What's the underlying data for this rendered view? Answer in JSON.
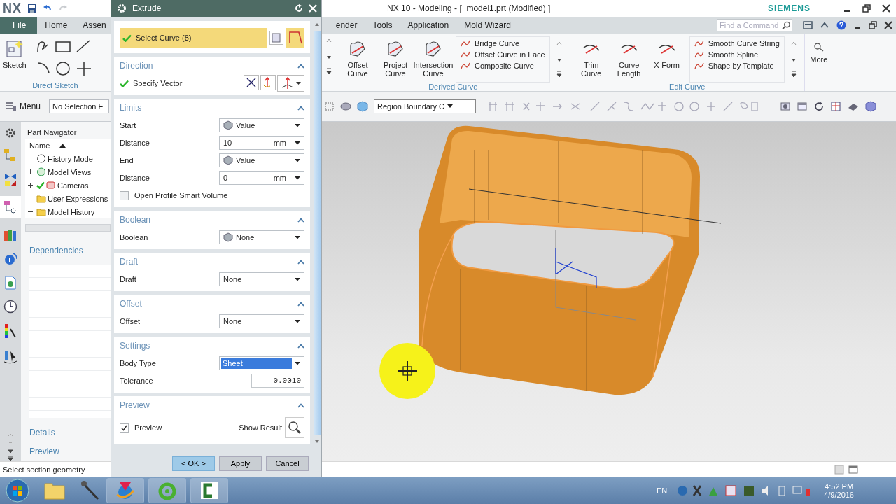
{
  "window": {
    "logo": "NX",
    "title": "NX 10 - Modeling - [_model1.prt (Modified) ]",
    "brand": "SIEMENS"
  },
  "menu_tabs": [
    {
      "label": "File",
      "selected": true
    },
    {
      "label": "Home",
      "selected": false
    },
    {
      "label": "Assen",
      "selected": false
    },
    {
      "label": "ender",
      "selected": false
    },
    {
      "label": "Tools",
      "selected": false
    },
    {
      "label": "Application",
      "selected": false
    },
    {
      "label": "Mold Wizard",
      "selected": false
    }
  ],
  "command_search": {
    "placeholder": "Find a Command"
  },
  "ribbon": {
    "direct_sketch": {
      "button": "Sketch",
      "label": "Direct Sketch"
    },
    "groups": [
      {
        "label": "Derived Curve",
        "large": [
          "Offset Curve",
          "Project Curve",
          "Intersection Curve"
        ],
        "small": [
          "Bridge Curve",
          "Offset Curve in Face",
          "Composite Curve"
        ]
      },
      {
        "label": "Edit Curve",
        "large": [
          "Trim Curve",
          "Curve Length",
          "X-Form"
        ],
        "small": [
          "Smooth Curve String",
          "Smooth Spline",
          "Shape by Template"
        ]
      }
    ],
    "more": "More"
  },
  "selection_bar": {
    "menu": "Menu",
    "filter": "No Selection F",
    "region": "Region Boundary C"
  },
  "navigator": {
    "title": "Part Navigator",
    "column": "Name",
    "items": [
      {
        "label": "History Mode",
        "checked": false
      },
      {
        "label": "Model Views",
        "expanded": false,
        "checked": false
      },
      {
        "label": "Cameras",
        "expanded": false,
        "checked": true
      },
      {
        "label": "User Expressions",
        "checked": false
      },
      {
        "label": "Model History",
        "expanded": true,
        "checked": false
      }
    ],
    "panels": [
      "Dependencies",
      "Details",
      "Preview"
    ]
  },
  "extrude_dialog": {
    "title": "Extrude",
    "selection": {
      "label": "Select Curve (8)",
      "complete": true
    },
    "sections": [
      {
        "title": "Direction",
        "expanded": true,
        "rows": [
          {
            "kind": "select",
            "label": "Specify Vector",
            "complete": true
          }
        ]
      },
      {
        "title": "Limits",
        "expanded": true,
        "rows": [
          {
            "kind": "dropdown",
            "label": "Start",
            "value": "Value",
            "icon": true,
            "highlighted": false
          },
          {
            "kind": "measure",
            "label": "Distance",
            "value": "10",
            "unit": "mm"
          },
          {
            "kind": "dropdown",
            "label": "End",
            "value": "Value",
            "icon": true,
            "highlighted": false
          },
          {
            "kind": "measure",
            "label": "Distance",
            "value": "0",
            "unit": "mm"
          },
          {
            "kind": "checkbox",
            "label": "Open Profile Smart Volume",
            "checked": false
          }
        ]
      },
      {
        "title": "Boolean",
        "expanded": true,
        "rows": [
          {
            "kind": "dropdown",
            "label": "Boolean",
            "value": "None",
            "icon": true,
            "highlighted": false
          }
        ]
      },
      {
        "title": "Draft",
        "expanded": true,
        "rows": [
          {
            "kind": "dropdown",
            "label": "Draft",
            "value": "None",
            "icon": false,
            "highlighted": false
          }
        ]
      },
      {
        "title": "Offset",
        "expanded": true,
        "rows": [
          {
            "kind": "dropdown",
            "label": "Offset",
            "value": "None",
            "icon": false,
            "highlighted": false
          }
        ]
      },
      {
        "title": "Settings",
        "expanded": true,
        "rows": [
          {
            "kind": "dropdown",
            "label": "Body Type",
            "value": "Sheet",
            "icon": false,
            "highlighted": true
          },
          {
            "kind": "number",
            "label": "Tolerance",
            "value": "0.0010"
          }
        ]
      },
      {
        "title": "Preview",
        "expanded": true,
        "rows": [
          {
            "kind": "preview",
            "label": "Preview",
            "checked": true,
            "button": "Show Result"
          }
        ]
      }
    ],
    "buttons": [
      {
        "label": "< OK >",
        "default": true
      },
      {
        "label": "Apply",
        "default": false
      },
      {
        "label": "Cancel",
        "default": false
      }
    ]
  },
  "status": "Select section geometry",
  "taskbar": {
    "language": "EN",
    "time": "4:52 PM",
    "date": "4/9/2016"
  }
}
